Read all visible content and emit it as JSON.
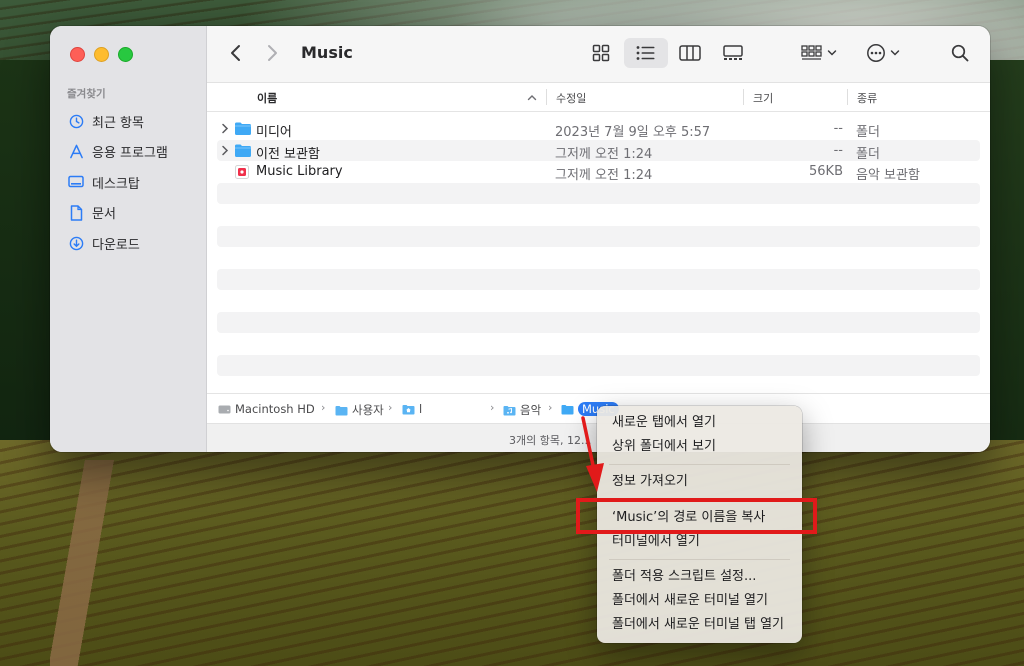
{
  "window": {
    "title": "Music"
  },
  "sidebar": {
    "heading": "즐겨찾기",
    "items": [
      {
        "label": "최근 항목",
        "icon": "clock-icon"
      },
      {
        "label": "응용 프로그램",
        "icon": "applications-icon"
      },
      {
        "label": "데스크탑",
        "icon": "desktop-icon"
      },
      {
        "label": "문서",
        "icon": "document-icon"
      },
      {
        "label": "다운로드",
        "icon": "download-icon"
      }
    ]
  },
  "columns": {
    "name": "이름",
    "date": "수정일",
    "size": "크기",
    "kind": "종류"
  },
  "rows": [
    {
      "name": "미디어",
      "date": "2023년 7월 9일 오후 5:57",
      "size": "--",
      "kind": "폴더"
    },
    {
      "name": "이전 보관함",
      "date": "그저께 오전 1:24",
      "size": "--",
      "kind": "폴더"
    },
    {
      "name": "Music Library",
      "date": "그저께 오전 1:24",
      "size": "56KB",
      "kind": "음악 보관함"
    }
  ],
  "pathbar": {
    "items": [
      "Macintosh HD",
      "사용자",
      "l",
      "음악",
      "Music"
    ]
  },
  "status": {
    "text": "3개의 항목, 12..."
  },
  "context_menu": {
    "items": [
      "새로운 탭에서 열기",
      "상위 폴더에서 보기",
      "정보 가져오기",
      "‘Music’의 경로 이름을 복사",
      "터미널에서 열기",
      "폴더 적용 스크립트 설정...",
      "폴더에서 새로운 터미널 열기",
      "폴더에서 새로운 터미널 탭 열기"
    ],
    "highlighted_item": "‘Music’의 경로 이름을 복사"
  },
  "colors": {
    "highlight_box": "#e11a1a",
    "selection_blue": "#2c7cf6",
    "folder_blue": "#3fa9f5"
  }
}
